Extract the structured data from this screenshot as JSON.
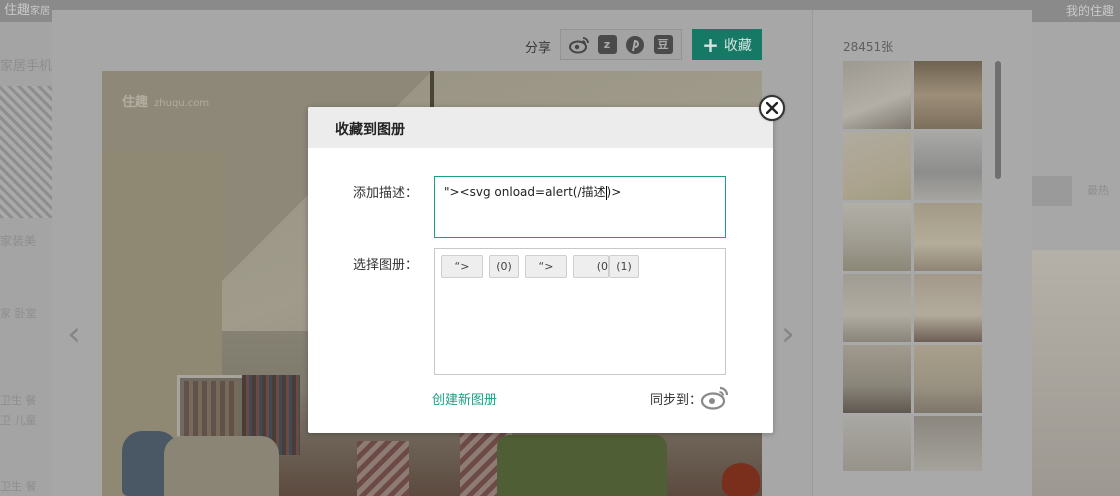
{
  "background": {
    "logo": "住趣",
    "logo_suffix": "家居",
    "user_link": "我的住趣",
    "left_title": "家居手机",
    "left_qr_text": "住趣",
    "left_section": "家装美",
    "left_nav": [
      [
        "家",
        "卧室"
      ],
      [
        "卫生",
        "餐"
      ],
      [
        "卫",
        "儿童"
      ],
      [
        "卫生",
        "餐"
      ]
    ],
    "right_button": "最热"
  },
  "viewer": {
    "share_label": "分享",
    "share_icons": [
      "weibo-icon",
      "qzone-icon",
      "pinterest-icon",
      "douban-icon"
    ],
    "qzone_letter": "z",
    "douban_letter": "豆",
    "collect_label": "收藏",
    "watermark": "住趣",
    "watermark_url": "zhuqu.com",
    "prev_arrow": "‹",
    "next_arrow": "›",
    "photo_count": "28451张"
  },
  "modal": {
    "title": "收藏到图册",
    "description_label": "添加描述：",
    "description_value_prefix": "\"><svg onload=alert(/",
    "description_value_typed": "描述",
    "description_value_suffix": ")>",
    "album_label": "选择图册：",
    "albums": [
      {
        "label": "“>"
      },
      {
        "label": "(0)"
      },
      {
        "label": "“>"
      },
      {
        "label": "(0"
      },
      {
        "label": "(1)"
      }
    ],
    "create_album": "创建新图册",
    "sync_label": "同步到："
  },
  "colors": {
    "accent": "#1a9f84",
    "collect_button": "#167966",
    "overlay": "#a7a7a7"
  }
}
